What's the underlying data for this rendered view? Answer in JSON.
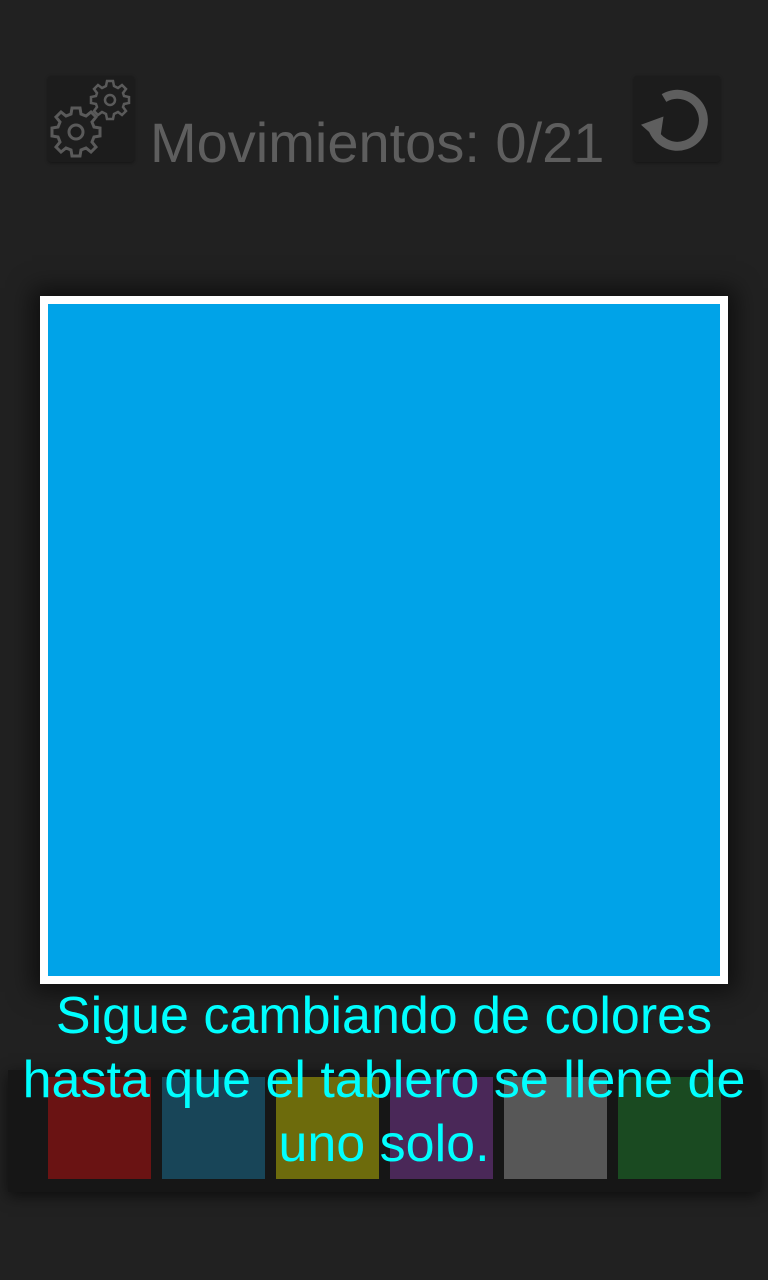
{
  "header": {
    "settings_icon": "gears-icon",
    "reset_icon": "refresh-icon",
    "moves_label": "Movimientos: 0/21"
  },
  "board": {
    "fill_color": "#00A3E8",
    "frame_color": "#FFFFFF"
  },
  "palette": {
    "colors": [
      "#D11010",
      "#1A7FA8",
      "#D8D200",
      "#8A3DA8",
      "#A6A6A6",
      "#1E8A2E"
    ]
  },
  "instructions": {
    "text": "Sigue cambiando de colores hasta que el tablero se llene de uno solo."
  },
  "colors": {
    "background": "#212121",
    "moves_text": "#5E5E5E",
    "instruction_text": "#00FFFF"
  }
}
